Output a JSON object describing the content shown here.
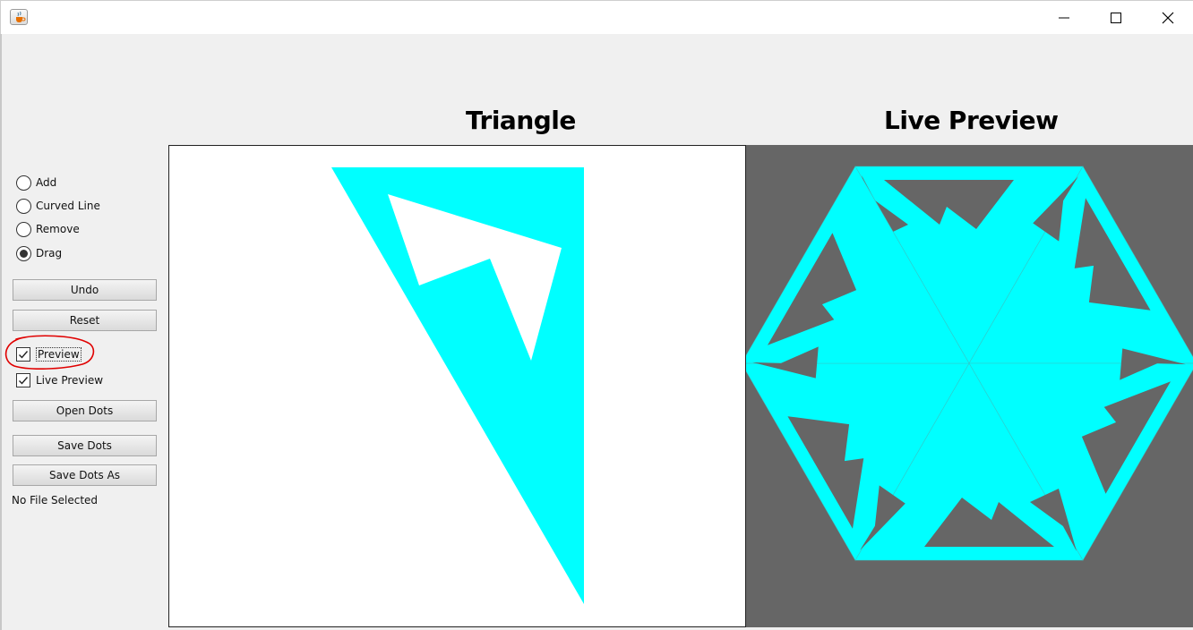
{
  "window": {
    "title": "",
    "app_icon": "java-cup-icon",
    "controls": [
      "minimize-icon",
      "maximize-icon",
      "close-icon"
    ]
  },
  "headings": {
    "triangle": "Triangle",
    "live_preview": "Live Preview"
  },
  "mode_options": [
    {
      "label": "Add",
      "selected": false
    },
    {
      "label": "Curved Line",
      "selected": false
    },
    {
      "label": "Remove",
      "selected": false
    },
    {
      "label": "Drag",
      "selected": true
    }
  ],
  "buttons": {
    "undo": "Undo",
    "reset": "Reset",
    "open_dots": "Open Dots",
    "save_dots": "Save Dots",
    "save_dots_as": "Save Dots As"
  },
  "checkboxes": {
    "preview": {
      "label": "Preview",
      "checked": true
    },
    "live_preview": {
      "label": "Live Preview",
      "checked": true
    }
  },
  "file_status": "No File Selected",
  "colors": {
    "shape_fill": "#00ffff",
    "preview_background": "#666666",
    "annotation": "#e00000"
  }
}
